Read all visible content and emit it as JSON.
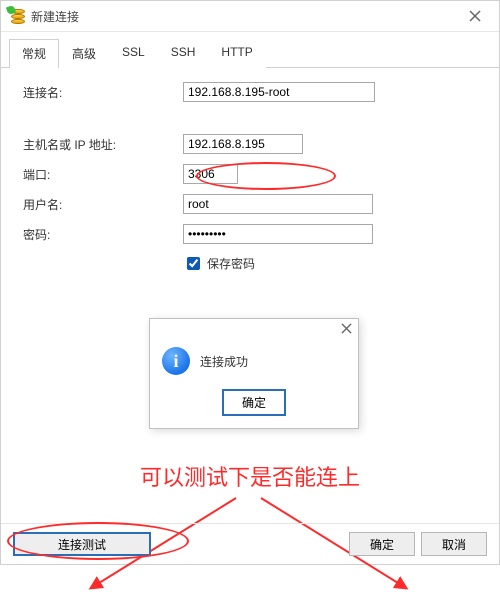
{
  "window": {
    "title": "新建连接"
  },
  "tabs": [
    "常规",
    "高级",
    "SSL",
    "SSH",
    "HTTP"
  ],
  "active_tab_index": 0,
  "form": {
    "conn_name_label": "连接名:",
    "conn_name_value": "192.168.8.195-root",
    "host_label": "主机名或 IP 地址:",
    "host_value": "192.168.8.195",
    "port_label": "端口:",
    "port_value": "3306",
    "user_label": "用户名:",
    "user_value": "root",
    "pass_label": "密码:",
    "pass_value": "•••••••••",
    "save_pass_label": "保存密码",
    "save_pass_checked": true
  },
  "msgbox": {
    "text": "连接成功",
    "ok": "确定"
  },
  "annotation": "可以测试下是否能连上",
  "footer": {
    "test": "连接测试",
    "ok": "确定",
    "cancel": "取消"
  }
}
